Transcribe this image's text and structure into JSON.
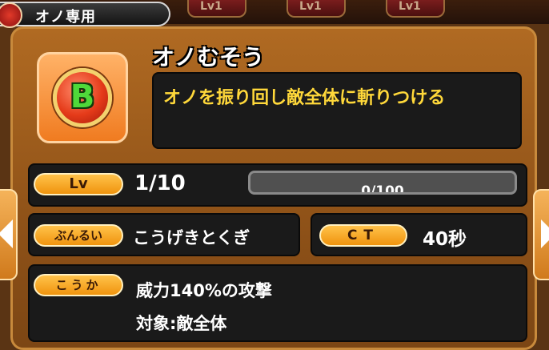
{
  "header": {
    "tag_label": "オノ専用",
    "tag_icon": "axe-emblem-icon"
  },
  "background_slots": [
    {
      "label": "Lv1"
    },
    {
      "label": "Lv1"
    },
    {
      "label": "Lv1"
    }
  ],
  "skill": {
    "name": "オノむそう",
    "description": "オノを振り回し敵全体に斬りつける",
    "icon": {
      "letter": "B",
      "name": "b-rank-gem-icon"
    }
  },
  "level": {
    "badge": "Lv",
    "value": "1/10"
  },
  "exp": {
    "label": "0/100",
    "current": 0,
    "max": 100
  },
  "category": {
    "badge": "ぶんるい",
    "value": "こうげきとくぎ"
  },
  "ct": {
    "badge": "CT",
    "value": "40秒"
  },
  "effect": {
    "badge": "こうか",
    "line1": "威力140%の攻撃",
    "line2": "対象:敵全体"
  },
  "colors": {
    "panel_wood": "#9a5a1c",
    "pill_orange": "#f0940e",
    "description_yellow": "#ffd83a",
    "gem_red": "#e53b1a",
    "gem_letter_green": "#4fd93a"
  }
}
